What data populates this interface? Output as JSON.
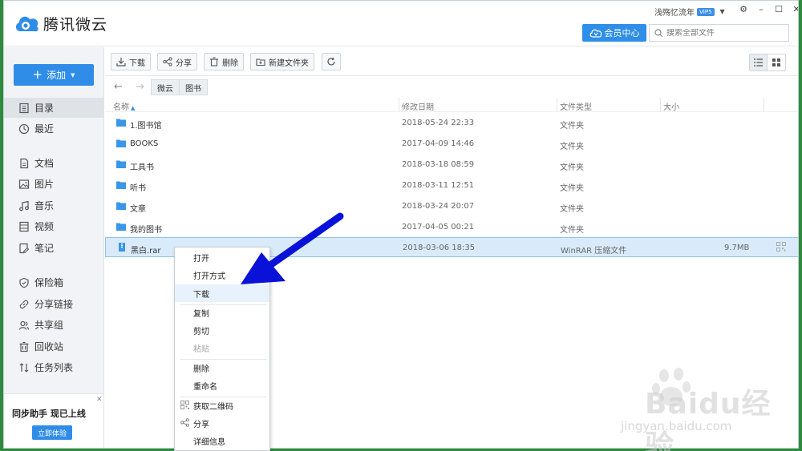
{
  "app": {
    "name": "腾讯微云",
    "user": "浅殇忆流年",
    "vip_badge": "VIP5",
    "vip_center": "会员中心",
    "search_placeholder": "搜索全部文件"
  },
  "window_controls": [
    "gear-icon",
    "minimize-icon",
    "maximize-icon",
    "close-icon"
  ],
  "sidebar": {
    "add_button": "添加",
    "items": [
      {
        "label": "目录",
        "icon": "directory-icon",
        "active": true
      },
      {
        "label": "最近",
        "icon": "clock-icon"
      },
      {
        "label": "文档",
        "icon": "document-icon"
      },
      {
        "label": "图片",
        "icon": "image-icon"
      },
      {
        "label": "音乐",
        "icon": "music-icon"
      },
      {
        "label": "视频",
        "icon": "video-icon"
      },
      {
        "label": "笔记",
        "icon": "note-icon"
      },
      {
        "label": "保险箱",
        "icon": "shield-icon"
      },
      {
        "label": "分享链接",
        "icon": "link-icon"
      },
      {
        "label": "共享组",
        "icon": "group-icon"
      },
      {
        "label": "回收站",
        "icon": "trash-icon"
      },
      {
        "label": "任务列表",
        "icon": "task-icon"
      }
    ],
    "promo_title": "同步助手 现已上线",
    "promo_button": "立即体验"
  },
  "toolbar": {
    "download": "下载",
    "share": "分享",
    "delete": "删除",
    "new_folder": "新建文件夹"
  },
  "breadcrumb": [
    "微云",
    "图书"
  ],
  "columns": {
    "name": "名称",
    "modified": "修改日期",
    "type": "文件类型",
    "size": "大小"
  },
  "files": [
    {
      "name": "1.图书馆",
      "date": "2018-05-24 22:33",
      "type": "文件夹",
      "size": ""
    },
    {
      "name": "BOOKS",
      "date": "2017-04-09 14:46",
      "type": "文件夹",
      "size": ""
    },
    {
      "name": "工具书",
      "date": "2018-03-18 08:59",
      "type": "文件夹",
      "size": ""
    },
    {
      "name": "听书",
      "date": "2018-03-11 12:51",
      "type": "文件夹",
      "size": ""
    },
    {
      "name": "文章",
      "date": "2018-03-24 20:07",
      "type": "文件夹",
      "size": ""
    },
    {
      "name": "我的图书",
      "date": "2017-04-05 00:21",
      "type": "文件夹",
      "size": ""
    },
    {
      "name": "黑白.rar",
      "date": "2018-03-06 18:35",
      "type": "WinRAR 压缩文件",
      "size": "9.7MB",
      "selected": true
    }
  ],
  "context_menu": [
    {
      "label": "打开"
    },
    {
      "label": "打开方式"
    },
    {
      "label": "下载",
      "highlight": true
    },
    {
      "label": "复制"
    },
    {
      "label": "剪切"
    },
    {
      "label": "粘贴",
      "disabled": true
    },
    {
      "label": "删除"
    },
    {
      "label": "重命名"
    },
    {
      "label": "获取二维码",
      "icon": "qrcode-icon"
    },
    {
      "label": "分享",
      "icon": "share-icon"
    },
    {
      "label": "详细信息"
    }
  ],
  "watermark": {
    "brand": "Baidu经验",
    "url": "jingyan.baidu.com"
  },
  "colors": {
    "accent": "#2f8de8",
    "selection": "#d9ebfb",
    "arrow": "#0a12d8",
    "background": "#2e8b3e"
  }
}
